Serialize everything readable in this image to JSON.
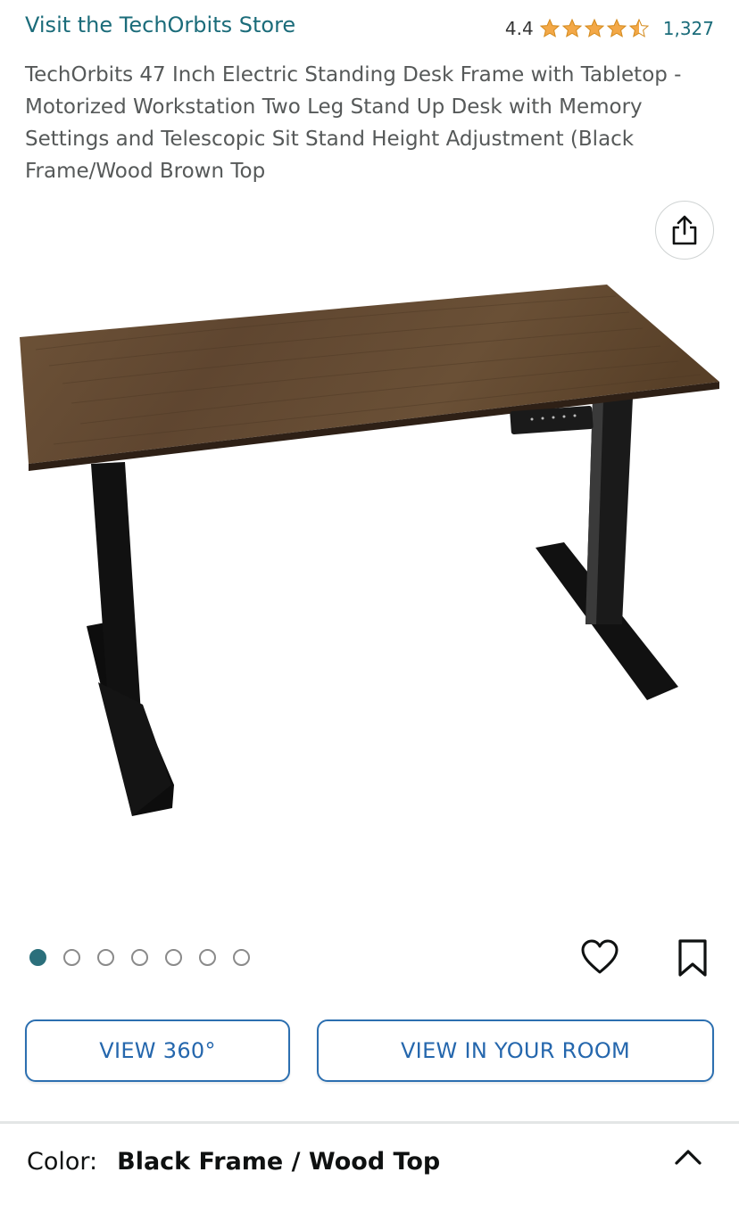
{
  "store": {
    "link_text": "Visit the TechOrbits Store"
  },
  "rating": {
    "value": "4.4",
    "stars": 4.5,
    "count": "1,327",
    "star_color": "#f3a847"
  },
  "product": {
    "title": "TechOrbits 47 Inch Electric Standing Desk Frame with Tabletop - Motorized Workstation Two Leg Stand Up Desk with Memory Settings and Telescopic Sit Stand Height Adjustment (Black Frame/Wood Brown Top"
  },
  "gallery": {
    "image_count": 7,
    "active_index": 0
  },
  "actions": {
    "share_icon": "share-icon",
    "wishlist_icon": "heart-icon",
    "save_icon": "bookmark-icon"
  },
  "buttons": {
    "view_360": "VIEW 360°",
    "view_in_room": "VIEW IN YOUR ROOM"
  },
  "variant": {
    "label": "Color:",
    "value": "Black Frame / Wood Top"
  },
  "colors": {
    "link": "#1b6c7a",
    "button": "#2567ad",
    "active_dot": "#2b6f7b"
  }
}
